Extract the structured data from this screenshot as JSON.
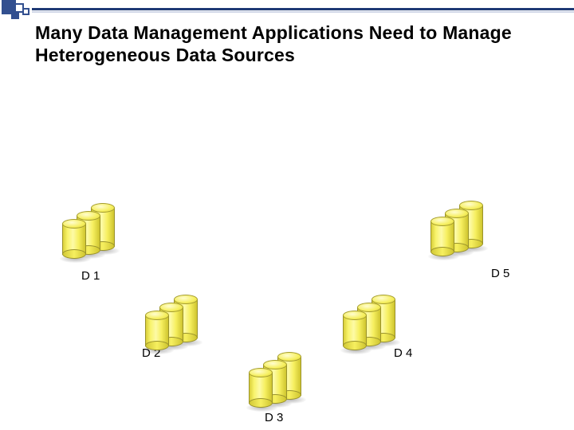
{
  "title": "Many Data Management Applications Need to Manage Heterogeneous Data Sources",
  "sources": {
    "d1": {
      "label": "D 1"
    },
    "d2": {
      "label": "D 2"
    },
    "d3": {
      "label": "D 3"
    },
    "d4": {
      "label": "D 4"
    },
    "d5": {
      "label": "D 5"
    }
  }
}
